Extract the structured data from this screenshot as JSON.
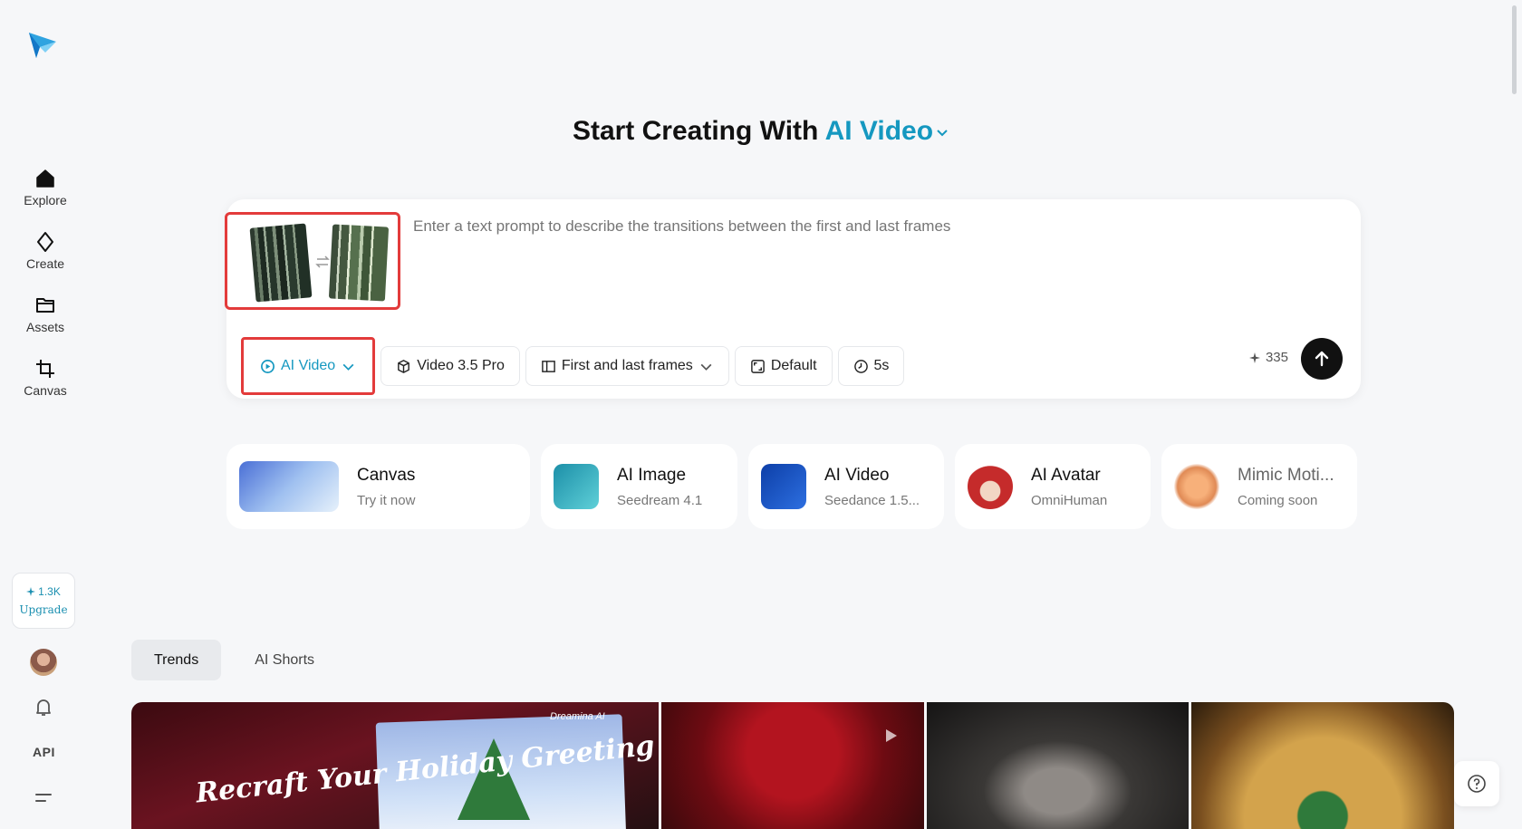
{
  "sidebar": {
    "items": [
      {
        "label": "Explore",
        "icon": "home-icon"
      },
      {
        "label": "Create",
        "icon": "diamond-icon"
      },
      {
        "label": "Assets",
        "icon": "folder-icon"
      },
      {
        "label": "Canvas",
        "icon": "crop-icon"
      }
    ],
    "credits": "1.3K",
    "upgrade": "Upgrade",
    "api": "API"
  },
  "header": {
    "title_prefix": "Start Creating With",
    "title_accent": "AI Video"
  },
  "prompt": {
    "placeholder": "Enter a text prompt to describe the transitions between the first and last frames",
    "chips": {
      "mode": "AI Video",
      "model": "Video 3.5 Pro",
      "frames": "First and last frames",
      "ratio": "Default",
      "duration": "5s"
    },
    "cost": "335"
  },
  "features": [
    {
      "name": "Canvas",
      "sub": "Try it now"
    },
    {
      "name": "AI Image",
      "sub": "Seedream 4.1"
    },
    {
      "name": "AI Video",
      "sub": "Seedance 1.5..."
    },
    {
      "name": "AI Avatar",
      "sub": "OmniHuman"
    },
    {
      "name": "Mimic Moti...",
      "sub": "Coming soon"
    }
  ],
  "tabs": [
    "Trends",
    "AI Shorts"
  ],
  "gallery": {
    "card1_text": "Recraft Your Holiday Greeting",
    "card1_brand": "Dreamina AI"
  },
  "colors": {
    "accent": "#1598c0",
    "highlight": "#e33b3b"
  }
}
